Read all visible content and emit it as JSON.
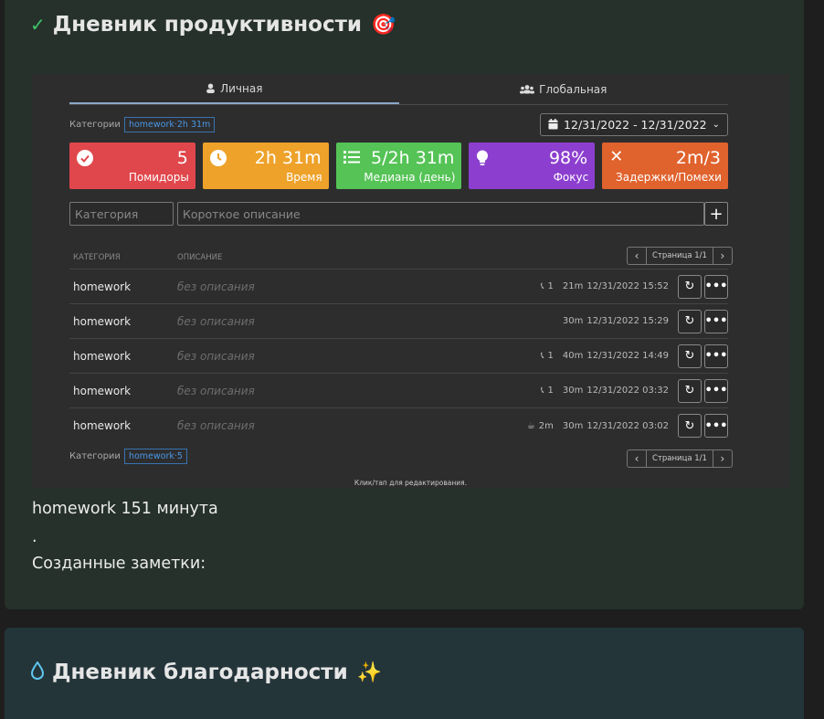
{
  "productivity": {
    "title": "Дневник продуктивности",
    "tabs": [
      {
        "label": "Личная"
      },
      {
        "label": "Глобальная"
      }
    ],
    "categories_label": "Категории",
    "category_chip": "homework·2h 31m",
    "date_range": "12/31/2022 - 12/31/2022",
    "stats": [
      {
        "value": "5",
        "label": "Помидоры",
        "color": "#e0474c"
      },
      {
        "value": "2h 31m",
        "label": "Время",
        "color": "#eea22a"
      },
      {
        "value": "5/2h 31m",
        "label": "Медиана (день)",
        "color": "#55c356"
      },
      {
        "value": "98%",
        "label": "Фокус",
        "color": "#8c3fcf"
      },
      {
        "value": "2m/3",
        "label": "Задержки/Помехи",
        "color": "#e0622d"
      }
    ],
    "category_placeholder": "Категория",
    "description_placeholder": "Короткое описание",
    "columns": {
      "category": "КАТЕГОРИЯ",
      "description": "ОПИСАНИЕ"
    },
    "page_label": "Страница 1/1",
    "rows": [
      {
        "category": "homework",
        "description": "без описания",
        "interrupt": "1",
        "duration": "21m",
        "datetime": "12/31/2022 15:52"
      },
      {
        "category": "homework",
        "description": "без описания",
        "interrupt": "",
        "duration": "30m",
        "datetime": "12/31/2022 15:29"
      },
      {
        "category": "homework",
        "description": "без описания",
        "interrupt": "1",
        "duration": "40m",
        "datetime": "12/31/2022 14:49"
      },
      {
        "category": "homework",
        "description": "без описания",
        "interrupt": "1",
        "duration": "30m",
        "datetime": "12/31/2022 03:32"
      },
      {
        "category": "homework",
        "description": "без описания",
        "break": "2m",
        "duration": "30m",
        "datetime": "12/31/2022 03:02"
      }
    ],
    "footer_chip": "homework·5",
    "hint": "Клик/тап для редактирования.",
    "summary": "homework 151 минута",
    "dot": ".",
    "notes_label": "Созданные заметки:"
  },
  "gratitude": {
    "title": "Дневник благодарности"
  }
}
